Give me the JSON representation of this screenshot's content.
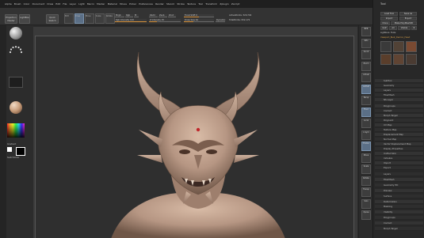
{
  "menu": {
    "items": [
      "Alpha",
      "Brush",
      "Color",
      "Document",
      "Draw",
      "Edit",
      "File",
      "Layer",
      "Light",
      "Macro",
      "Marker",
      "Material",
      "Movie",
      "Picker",
      "Preferences",
      "Render",
      "Stencil",
      "Stroke",
      "Texture",
      "Tool",
      "Transform",
      "Zplugin",
      "Zscript"
    ]
  },
  "coordinates": "-0.605,-0.415,0.294",
  "shelf": {
    "projection_master": "Projection Master",
    "lightbox": "LightBox",
    "quick_sketch": "Quick Sketch",
    "edit": "Edit",
    "draw": "Draw",
    "move": "Move",
    "scale": "Scale",
    "rotate": "Rotate",
    "mrgb": "Mrgb",
    "rgb": "Rgb",
    "m": "M",
    "zadd": "Zadd",
    "zsub": "Zsub",
    "zcut": "Zcut",
    "rgb_intensity": "Rgb Intensity 100",
    "z_intensity": "Z Intensity 25",
    "focal_shift": "Focal Shift 0",
    "draw_size": "Draw Size 64",
    "dynamic": "Dynamic",
    "active_points": "ActivePoints: 320,704",
    "total_points": "TotalPoints: 952,172"
  },
  "left_tray": {
    "color_label": "Gradient",
    "switch_label": "SwitchColor"
  },
  "right_toolbar": [
    "BPR",
    "SPix",
    "Scroll",
    "Zoom",
    "Actual",
    "AAHalf",
    "Persp",
    "Floor",
    "Local",
    "L.Sym",
    "Frame",
    "Move",
    "Scale",
    "Rotate",
    "Transp",
    "Solo",
    "Xpose"
  ],
  "right_panel": {
    "title": "Tool",
    "load_tool": "Load Tool",
    "save_as": "Save As",
    "import": "Import",
    "export": "Export",
    "clone": "Clone",
    "make_polymesh": "Make PolyMesh3D",
    "goz": "GoZ",
    "all": "All",
    "visible": "Visible",
    "r": "R",
    "lightbox_tools": "Lightbox› Tools",
    "current_tool": "Viewport_Bust_Demon_Head",
    "subtool": "SubTool",
    "geometry": "Geometry",
    "layers": "Layers",
    "fibermesh": "FiberMesh",
    "ns_layer": "NS Layer",
    "list": [
      "Polygroups",
      "Contact",
      "Morph Target",
      "Polypaint",
      "UV Map",
      "Texture Map",
      "Displacement Map",
      "Normal Map",
      "Vector Displacement Map",
      "Display Properties",
      "Unified Skin",
      "Initialize",
      "Import",
      "Export"
    ],
    "list2": [
      "Layers",
      "FiberMesh",
      "Geometry HD",
      "Preview",
      "Surface",
      "Deformation",
      "Masking",
      "Visibility",
      "Polygroups",
      "Contact",
      "Morph Target"
    ]
  }
}
